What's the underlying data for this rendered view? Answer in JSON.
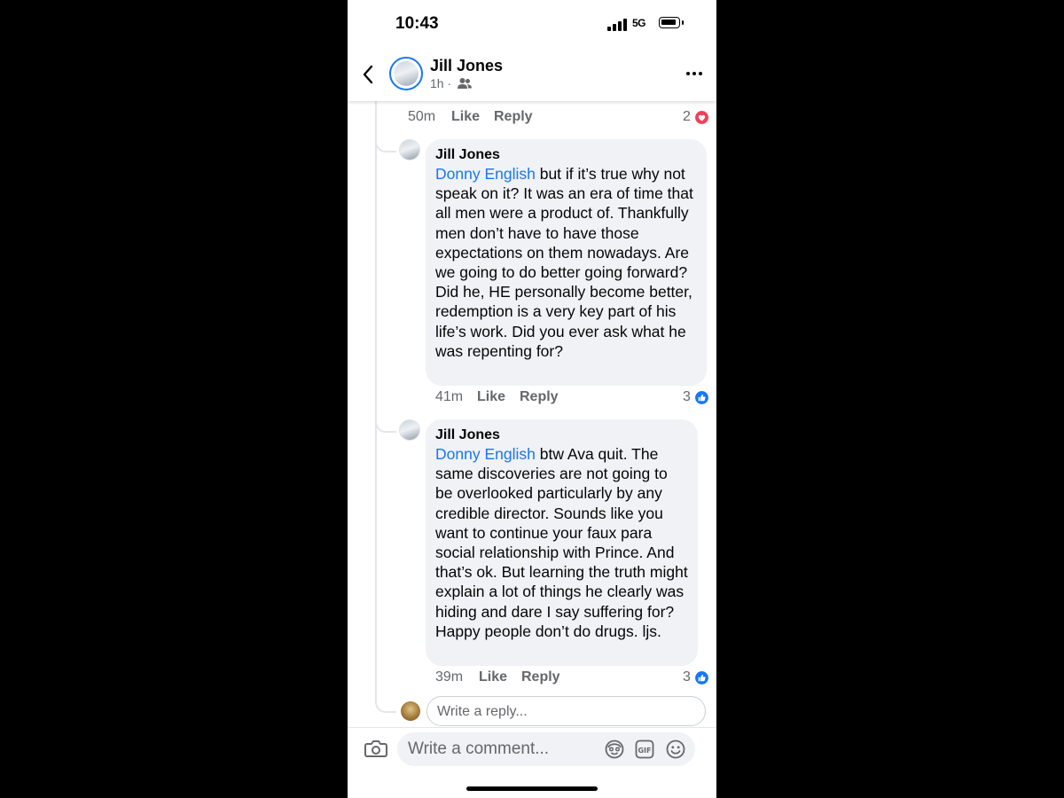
{
  "status": {
    "time": "10:43",
    "network": "5G"
  },
  "header": {
    "name": "Jill Jones",
    "age": "1h",
    "separator": "·"
  },
  "prev_comment": {
    "time": "50m",
    "like": "Like",
    "reply": "Reply",
    "reactions": "2",
    "reaction_type": "love"
  },
  "replies": [
    {
      "author": "Jill Jones",
      "mention": "Donny English",
      "text": " but if it’s true why not speak on it? It was an era of time that all men were a product of. Thankfully men don’t have to have those expectations on them nowadays. Are we going to do better going forward? Did he, HE personally become better, redemption is a very key part of his life’s work. Did you ever ask what he was repenting for?",
      "time": "41m",
      "like": "Like",
      "reply": "Reply",
      "reactions": "3",
      "reaction_type": "like"
    },
    {
      "author": "Jill Jones",
      "mention": "Donny English",
      "text": " btw Ava quit. The same discoveries are not going to be overlooked particularly by any credible director. Sounds like you want to continue your faux para social relationship with Prince. And that’s ok. But learning the truth might explain a lot of things he clearly was hiding and dare I say suffering for? Happy people don’t do drugs. ljs.",
      "time": "39m",
      "like": "Like",
      "reply": "Reply",
      "reactions": "3",
      "reaction_type": "like"
    }
  ],
  "reply_input": {
    "placeholder": "Write a reply..."
  },
  "composer": {
    "placeholder": "Write a comment..."
  },
  "colors": {
    "link": "#1877f2",
    "love": "#f33e58",
    "bubble": "#f0f2f5"
  }
}
